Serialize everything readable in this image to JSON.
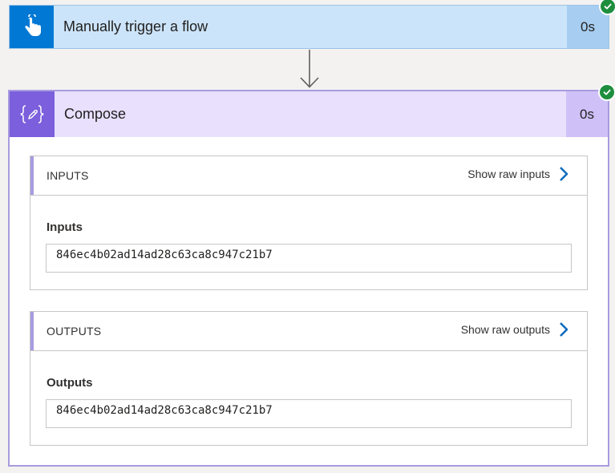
{
  "trigger": {
    "title": "Manually trigger a flow",
    "duration": "0s",
    "icon": "touch-hand-icon",
    "status": "succeeded",
    "colors": {
      "icon_bg": "#0078d4",
      "header_bg": "#cce4f9",
      "duration_bg": "#a7cdf0"
    }
  },
  "compose": {
    "title": "Compose",
    "duration": "0s",
    "icon": "compose-braces-icon",
    "status": "succeeded",
    "colors": {
      "icon_bg": "#7b5fdc",
      "header_bg": "#e8e0fd",
      "duration_bg": "#cfc1f7",
      "border": "#a99be0"
    },
    "inputs": {
      "section_title": "INPUTS",
      "raw_link": "Show raw inputs",
      "field_label": "Inputs",
      "field_value": "846ec4b02ad14ad28c63ca8c947c21b7"
    },
    "outputs": {
      "section_title": "OUTPUTS",
      "raw_link": "Show raw outputs",
      "field_label": "Outputs",
      "field_value": "846ec4b02ad14ad28c63ca8c947c21b7"
    }
  },
  "status_color": "#1e8e3e",
  "link_chevron_color": "#0f6cbd"
}
